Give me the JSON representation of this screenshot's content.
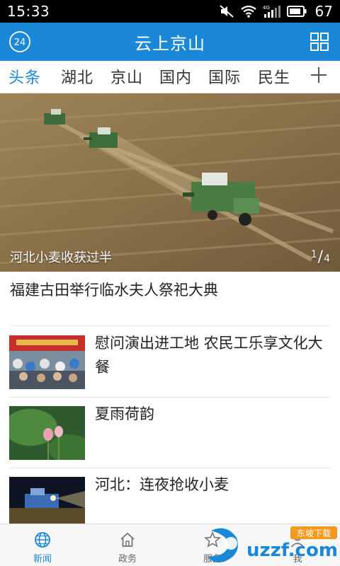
{
  "status_bar": {
    "time": "15:33",
    "battery": "67"
  },
  "header": {
    "badge": "24",
    "title": "云上京山"
  },
  "tabs": [
    {
      "label": "头条",
      "active": true
    },
    {
      "label": "湖北",
      "active": false
    },
    {
      "label": "京山",
      "active": false
    },
    {
      "label": "国内",
      "active": false
    },
    {
      "label": "国际",
      "active": false
    },
    {
      "label": "民生",
      "active": false
    }
  ],
  "hero": {
    "caption": "河北小麦收获过半",
    "page_current": "1",
    "page_total": "4"
  },
  "featured": {
    "title": "福建古田举行临水夫人祭祀大典"
  },
  "news": [
    {
      "title": "慰问演出进工地 农民工乐享文化大餐",
      "thumb": "concert-crowd"
    },
    {
      "title": "夏雨荷韵",
      "thumb": "lotus"
    },
    {
      "title": "河北：连夜抢收小麦",
      "thumb": "night-harvest"
    }
  ],
  "bottom_nav": [
    {
      "label": "新闻",
      "icon": "globe-icon",
      "active": true
    },
    {
      "label": "政务",
      "icon": "home-icon",
      "active": false
    },
    {
      "label": "服务",
      "icon": "star-icon",
      "active": false
    },
    {
      "label": "我",
      "icon": "user-icon",
      "active": false
    }
  ],
  "watermark": {
    "text": "uzzf.com",
    "badge": "东坡下载"
  },
  "colors": {
    "accent": "#1a88d6",
    "header_bg": "#1a88d6"
  }
}
